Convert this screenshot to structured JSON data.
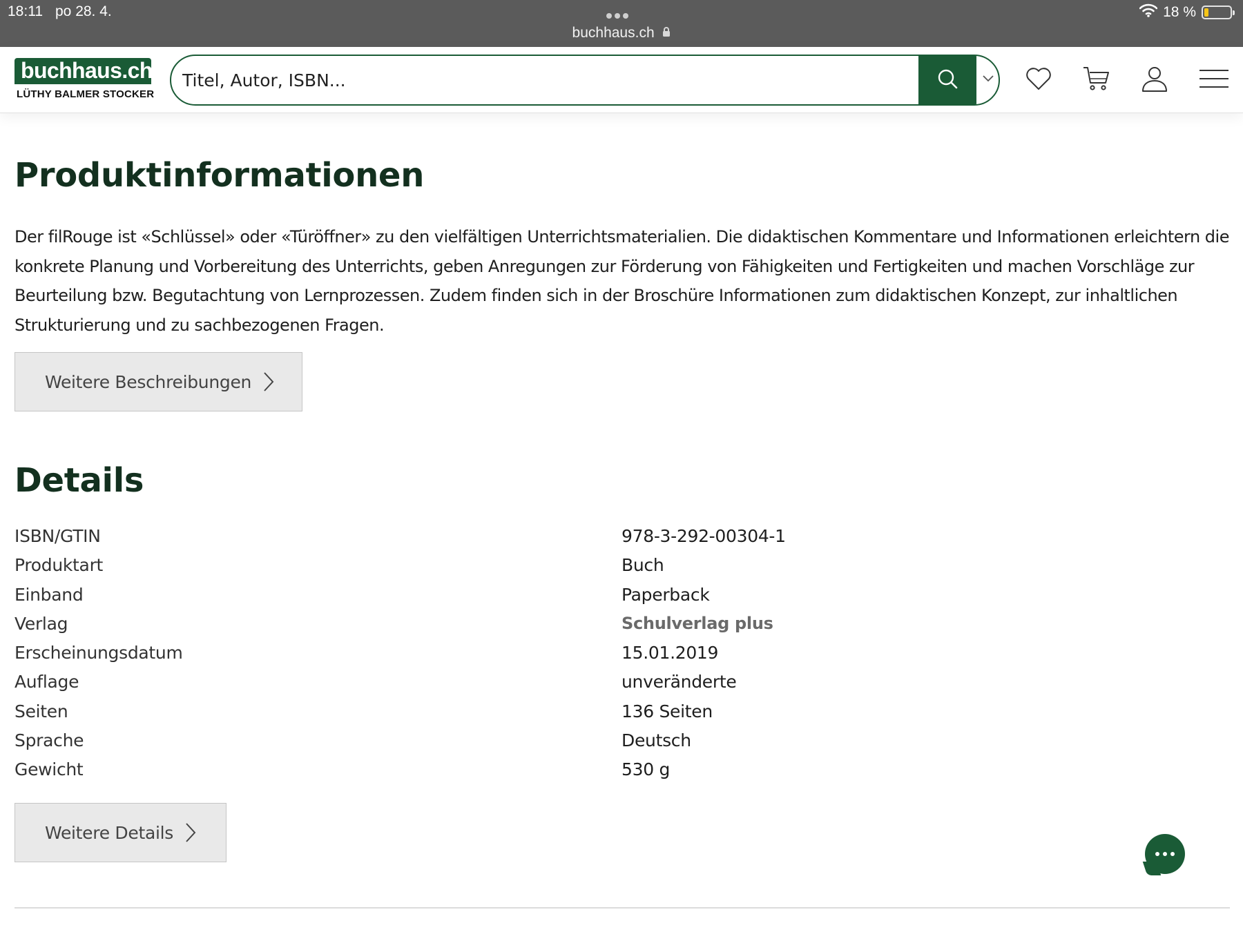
{
  "statusbar": {
    "time": "18:11",
    "date": "po 28. 4.",
    "url": "buchhaus.ch",
    "battery_text": "18 %",
    "battery_level": 0.18,
    "battery_color": "#f5c518",
    "icons": [
      "wifi-icon",
      "lock-icon",
      "battery-icon"
    ]
  },
  "header": {
    "logo_main": "buchhaus.ch",
    "logo_sub": "LÜTHY BALMER STOCKER",
    "search_placeholder": "Titel, Autor, ISBN...",
    "icons": [
      "search-icon",
      "chevron-down-icon",
      "heart-icon",
      "cart-icon",
      "user-icon",
      "menu-icon"
    ]
  },
  "product_info": {
    "title": "Produktinformationen",
    "description": "Der filRouge ist «Schlüssel» oder «Türöffner» zu den vielfältigen Unterrichtsmaterialien. Die didaktischen Kommentare und Informationen erleichtern die konkrete Planung und Vorbereitung des Unterrichts, geben Anregungen zur Förderung von Fähigkeiten und Fertigkeiten und machen Vorschläge zur Beurteilung bzw. Begutachtung von Lernprozessen. Zudem finden sich in der Broschüre Informationen zum didaktischen Konzept, zur inhaltlichen Strukturierung und zu sachbezogenen Fragen.",
    "more_button": "Weitere Beschreibungen"
  },
  "details": {
    "title": "Details",
    "rows": [
      {
        "label": "ISBN/GTIN",
        "value": "978-3-292-00304-1"
      },
      {
        "label": "Produktart",
        "value": "Buch"
      },
      {
        "label": "Einband",
        "value": "Paperback"
      },
      {
        "label": "Verlag",
        "value": "Schulverlag plus"
      },
      {
        "label": "Erscheinungsdatum",
        "value": "15.01.2019"
      },
      {
        "label": "Auflage",
        "value": "unveränderte"
      },
      {
        "label": "Seiten",
        "value": "136 Seiten"
      },
      {
        "label": "Sprache",
        "value": "Deutsch"
      },
      {
        "label": "Gewicht",
        "value": "530 g"
      }
    ],
    "more_button": "Weitere Details"
  },
  "colors": {
    "brand_green": "#1a5b36",
    "heading_dark": "#13301f",
    "statusbar_bg": "#5b5b5b",
    "button_bg": "#e9e9e9"
  }
}
